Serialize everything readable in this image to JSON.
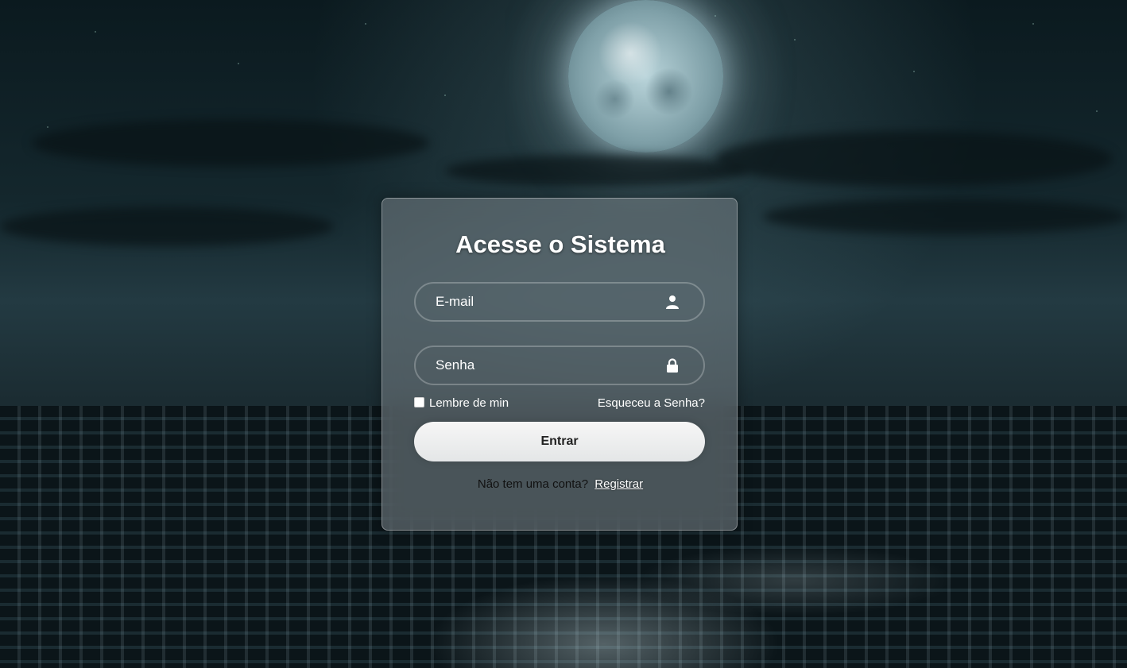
{
  "login": {
    "title": "Acesse o Sistema",
    "email_placeholder": "E-mail",
    "password_placeholder": "Senha",
    "remember_label": "Lembre de min",
    "forgot_label": "Esqueceu a Senha?",
    "submit_label": "Entrar",
    "register_prompt": "Não tem uma conta?",
    "register_link": "Registrar",
    "email_icon": "user-icon",
    "password_icon": "lock-icon"
  },
  "background": {
    "description_icon": "night-city-moon-image"
  }
}
